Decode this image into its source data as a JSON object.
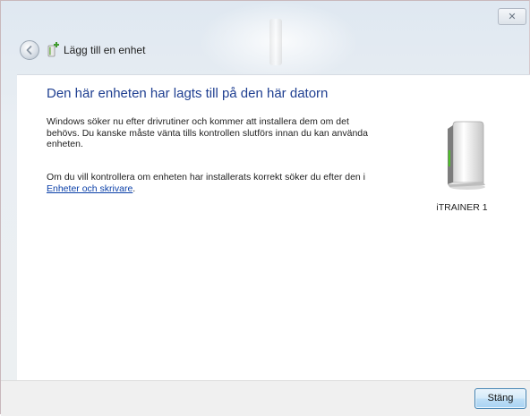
{
  "window": {
    "title": "Lägg till en enhet",
    "close_glyph": "✕"
  },
  "main": {
    "heading": "Den här enheten har lagts till på den här datorn",
    "paragraph1": "Windows söker nu efter drivrutiner och kommer att installera dem om det behövs. Du kanske måste vänta tills kontrollen slutförs innan du kan använda enheten.",
    "paragraph2_before": "Om du vill kontrollera om enheten har installerats korrekt söker du efter den i ",
    "paragraph2_link": "Enheter och skrivare",
    "paragraph2_after": "."
  },
  "device": {
    "name": "iTRAINER 1",
    "icon": "external-drive-icon"
  },
  "footer": {
    "close_label": "Stäng"
  },
  "icons": {
    "back": "back-arrow-icon",
    "title": "add-device-icon"
  }
}
